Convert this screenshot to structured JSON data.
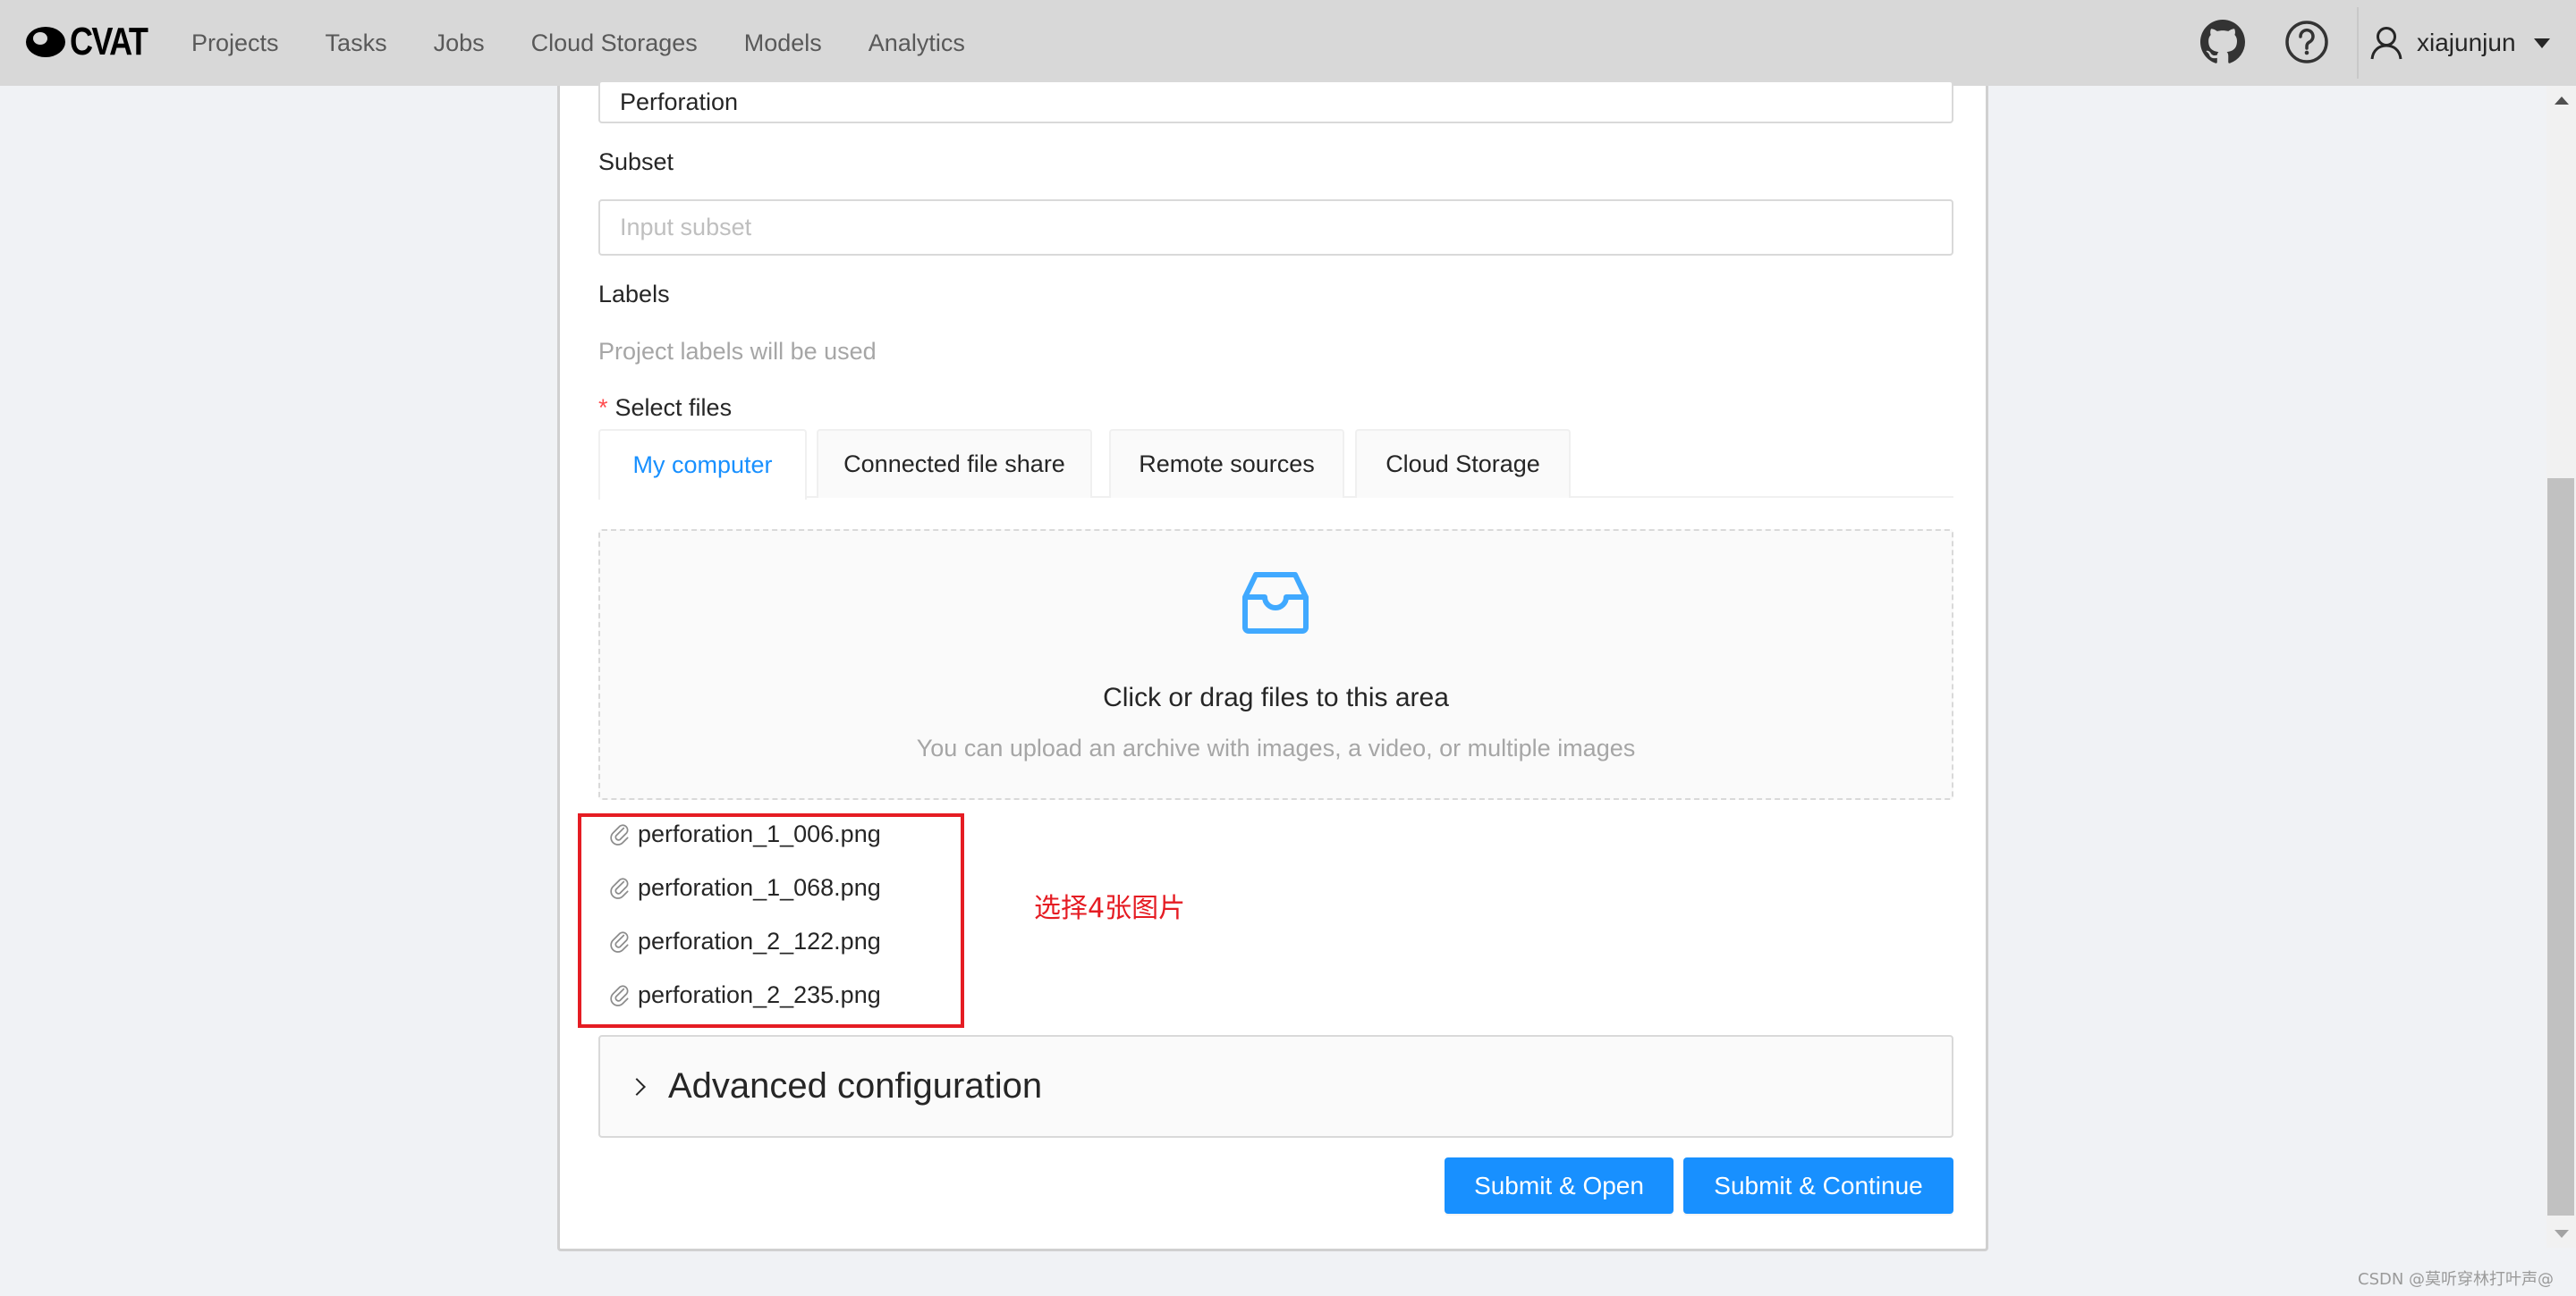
{
  "header": {
    "logo_text": "CVAT",
    "nav": [
      "Projects",
      "Tasks",
      "Jobs",
      "Cloud Storages",
      "Models",
      "Analytics"
    ],
    "github_icon": "github-icon",
    "help_icon": "question-circle-icon",
    "user": {
      "icon": "user-icon",
      "name": "xiajunjun"
    }
  },
  "form": {
    "project_value": "Perforation",
    "subset": {
      "label": "Subset",
      "placeholder": "Input subset"
    },
    "labels": {
      "label": "Labels",
      "note": "Project labels will be used"
    },
    "select_files": {
      "required_mark": "*",
      "label": "Select files",
      "tabs": [
        {
          "label": "My computer",
          "active": true
        },
        {
          "label": "Connected file share",
          "active": false
        },
        {
          "label": "Remote sources",
          "active": false
        },
        {
          "label": "Cloud Storage",
          "active": false
        }
      ],
      "dropzone": {
        "icon": "inbox-icon",
        "title": "Click or drag files to this area",
        "hint": "You can upload an archive with images, a video, or multiple images"
      },
      "files": [
        "perforation_1_006.png",
        "perforation_1_068.png",
        "perforation_2_122.png",
        "perforation_2_235.png"
      ]
    },
    "advanced": {
      "label": "Advanced configuration"
    },
    "buttons": {
      "submit_open": "Submit & Open",
      "submit_continue": "Submit & Continue"
    }
  },
  "annotation": {
    "text": "选择4张图片",
    "color": "#e51c23"
  },
  "watermark": "CSDN @莫听穿林打叶声@",
  "colors": {
    "primary": "#1890ff",
    "header_bg": "#d8d8d8",
    "page_bg": "#f0f2f5"
  }
}
